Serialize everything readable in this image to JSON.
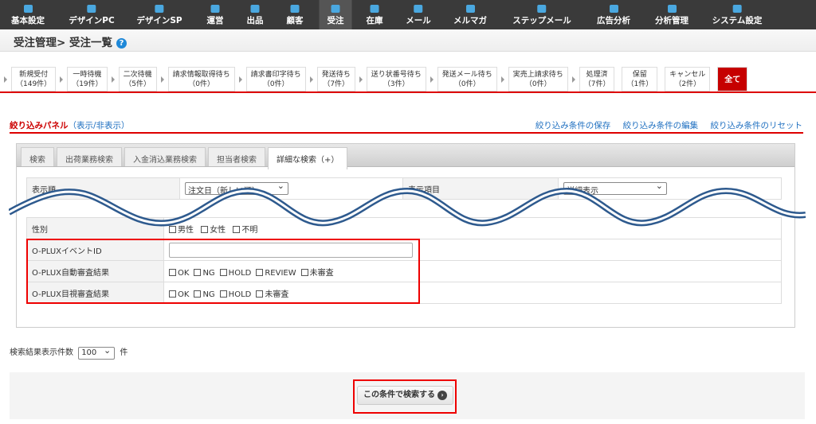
{
  "nav": [
    {
      "label": "基本設定",
      "icon": "sliders-icon"
    },
    {
      "label": "デザインPC",
      "icon": "monitor-icon"
    },
    {
      "label": "デザインSP",
      "icon": "smartphone-icon"
    },
    {
      "label": "運営",
      "icon": "store-icon"
    },
    {
      "label": "出品",
      "icon": "tag-icon"
    },
    {
      "label": "顧客",
      "icon": "user-icon"
    },
    {
      "label": "受注",
      "icon": "cart-icon",
      "active": true
    },
    {
      "label": "在庫",
      "icon": "box-icon"
    },
    {
      "label": "メール",
      "icon": "mail-icon"
    },
    {
      "label": "メルマガ",
      "icon": "newsletter-icon"
    },
    {
      "label": "ステップメール",
      "icon": "step-mail-icon"
    },
    {
      "label": "広告分析",
      "icon": "bars-icon"
    },
    {
      "label": "分析管理",
      "icon": "chart-icon"
    },
    {
      "label": "システム設定",
      "icon": "gear-icon"
    }
  ],
  "breadcrumb": "受注管理> 受注一覧",
  "steps": [
    {
      "label": "新規受付",
      "count": "（149件）"
    },
    {
      "label": "一時待機",
      "count": "（19件）"
    },
    {
      "label": "二次待機",
      "count": "（5件）"
    },
    {
      "label": "請求情報取得待ち",
      "count": "（0件）"
    },
    {
      "label": "請求書印字待ち",
      "count": "（0件）"
    },
    {
      "label": "発送待ち",
      "count": "（7件）"
    },
    {
      "label": "送り状番号待ち",
      "count": "（3件）"
    },
    {
      "label": "発送メール待ち",
      "count": "（0件）"
    },
    {
      "label": "実売上請求待ち",
      "count": "（0件）"
    },
    {
      "label": "処理済",
      "count": "（7件）"
    },
    {
      "label": "保留",
      "count": "（1件）"
    },
    {
      "label": "キャンセル",
      "count": "（2件）"
    }
  ],
  "all_label": "全て",
  "filter": {
    "title": "絞り込みパネル",
    "toggle": "（表示/非表示）",
    "links": [
      "絞り込み条件の保存",
      "絞り込み条件の編集",
      "絞り込み条件のリセット"
    ]
  },
  "tabs": [
    "検索",
    "出荷業務検索",
    "入金消込業務検索",
    "担当者検索",
    "詳細な検索（+）"
  ],
  "sort": {
    "label": "表示順",
    "value": "注文日（新しい順）",
    "display_label": "表示項目",
    "display_value": "詳細表示"
  },
  "gender": {
    "label": "性別",
    "options": [
      "男性",
      "女性",
      "不明"
    ]
  },
  "oplux_event": {
    "label": "O-PLUXイベントID",
    "value": ""
  },
  "oplux_auto": {
    "label": "O-PLUX自動審査結果",
    "options": [
      "OK",
      "NG",
      "HOLD",
      "REVIEW",
      "未審査"
    ]
  },
  "oplux_visual": {
    "label": "O-PLUX目視審査結果",
    "options": [
      "OK",
      "NG",
      "HOLD",
      "未審査"
    ]
  },
  "result_count": {
    "label": "検索結果表示件数",
    "value": "100",
    "unit": "件"
  },
  "search_button": "この条件で検索する"
}
